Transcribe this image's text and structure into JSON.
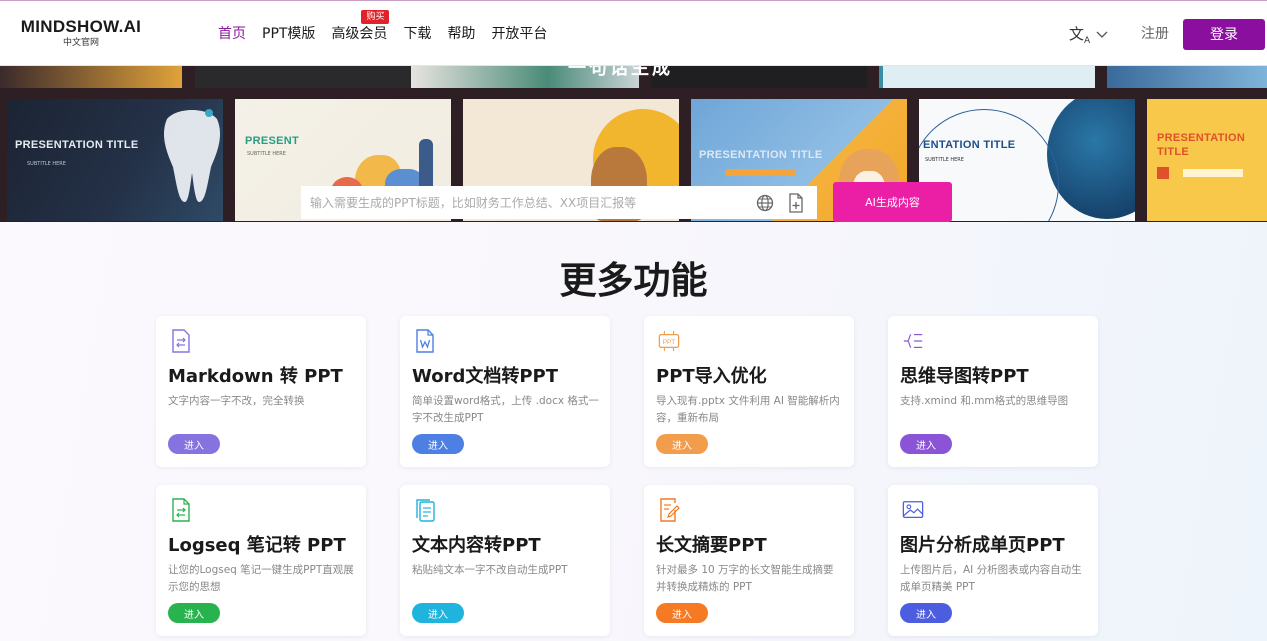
{
  "logo": {
    "main": "MINDSHOW.AI",
    "sub": "中文官网"
  },
  "nav": {
    "items": [
      {
        "label": "首页",
        "active": true
      },
      {
        "label": "PPT模版"
      },
      {
        "label": "高级会员",
        "badge": "购买"
      },
      {
        "label": "下载"
      },
      {
        "label": "帮助"
      },
      {
        "label": "开放平台"
      }
    ]
  },
  "header": {
    "lang_icon": "translate-icon",
    "register": "注册",
    "login": "登录"
  },
  "banner": {
    "heading": "一句话生成",
    "thumbs": [
      {
        "title": "PRESENTATION TITLE",
        "sub": "SUBTITLE HERE"
      },
      {
        "title": "PRESENT",
        "sub": "SUBTITLE HERE"
      },
      {
        "title": "PRESENTATION TITLE",
        "sub": ""
      },
      {
        "title": "ENTATION TITLE",
        "sub": "SUBTITLE HERE"
      },
      {
        "title": "PRESENTATION TITLE",
        "sub": ""
      }
    ]
  },
  "search": {
    "placeholder": "输入需要生成的PPT标题，比如财务工作总结、XX项目汇报等",
    "icons": [
      "globe-icon",
      "file-upload-icon"
    ],
    "button": "AI生成内容"
  },
  "features": {
    "title": "更多功能",
    "enter_label": "进入",
    "colors": {
      "purple": "#8673e0",
      "blue": "#4e7fe3",
      "orange": "#f29d4b",
      "violet": "#8b54d6",
      "green": "#29b34f",
      "cyan": "#1fb4de",
      "deep_orange": "#f57a23",
      "indigo": "#4d5de0"
    },
    "cards": [
      {
        "title": "Markdown 转 PPT",
        "desc": "文字内容一字不改，完全转换",
        "icon": "markdown-file-icon"
      },
      {
        "title": "Word文档转PPT",
        "desc": "简单设置word格式，上传 .docx 格式一字不改生成PPT",
        "icon": "word-file-icon"
      },
      {
        "title": "PPT导入优化",
        "desc": "导入现有.pptx 文件利用 AI 智能解析内容，重新布局",
        "icon": "ppt-icon"
      },
      {
        "title": "思维导图转PPT",
        "desc": "支持.xmind 和.mm格式的思维导图",
        "icon": "mindmap-icon"
      },
      {
        "title": "Logseq 笔记转 PPT",
        "desc": "让您的Logseq 笔记一键生成PPT直观展示您的思想",
        "icon": "logseq-file-icon"
      },
      {
        "title": "文本内容转PPT",
        "desc": "粘贴纯文本一字不改自动生成PPT",
        "icon": "text-copy-icon"
      },
      {
        "title": "长文摘要PPT",
        "desc": "针对最多 10 万字的长文智能生成摘要并转换成精炼的 PPT",
        "icon": "summary-edit-icon"
      },
      {
        "title": "图片分析成单页PPT",
        "desc": "上传图片后，AI 分析图表或内容自动生成单页精美 PPT",
        "icon": "image-icon"
      }
    ]
  }
}
